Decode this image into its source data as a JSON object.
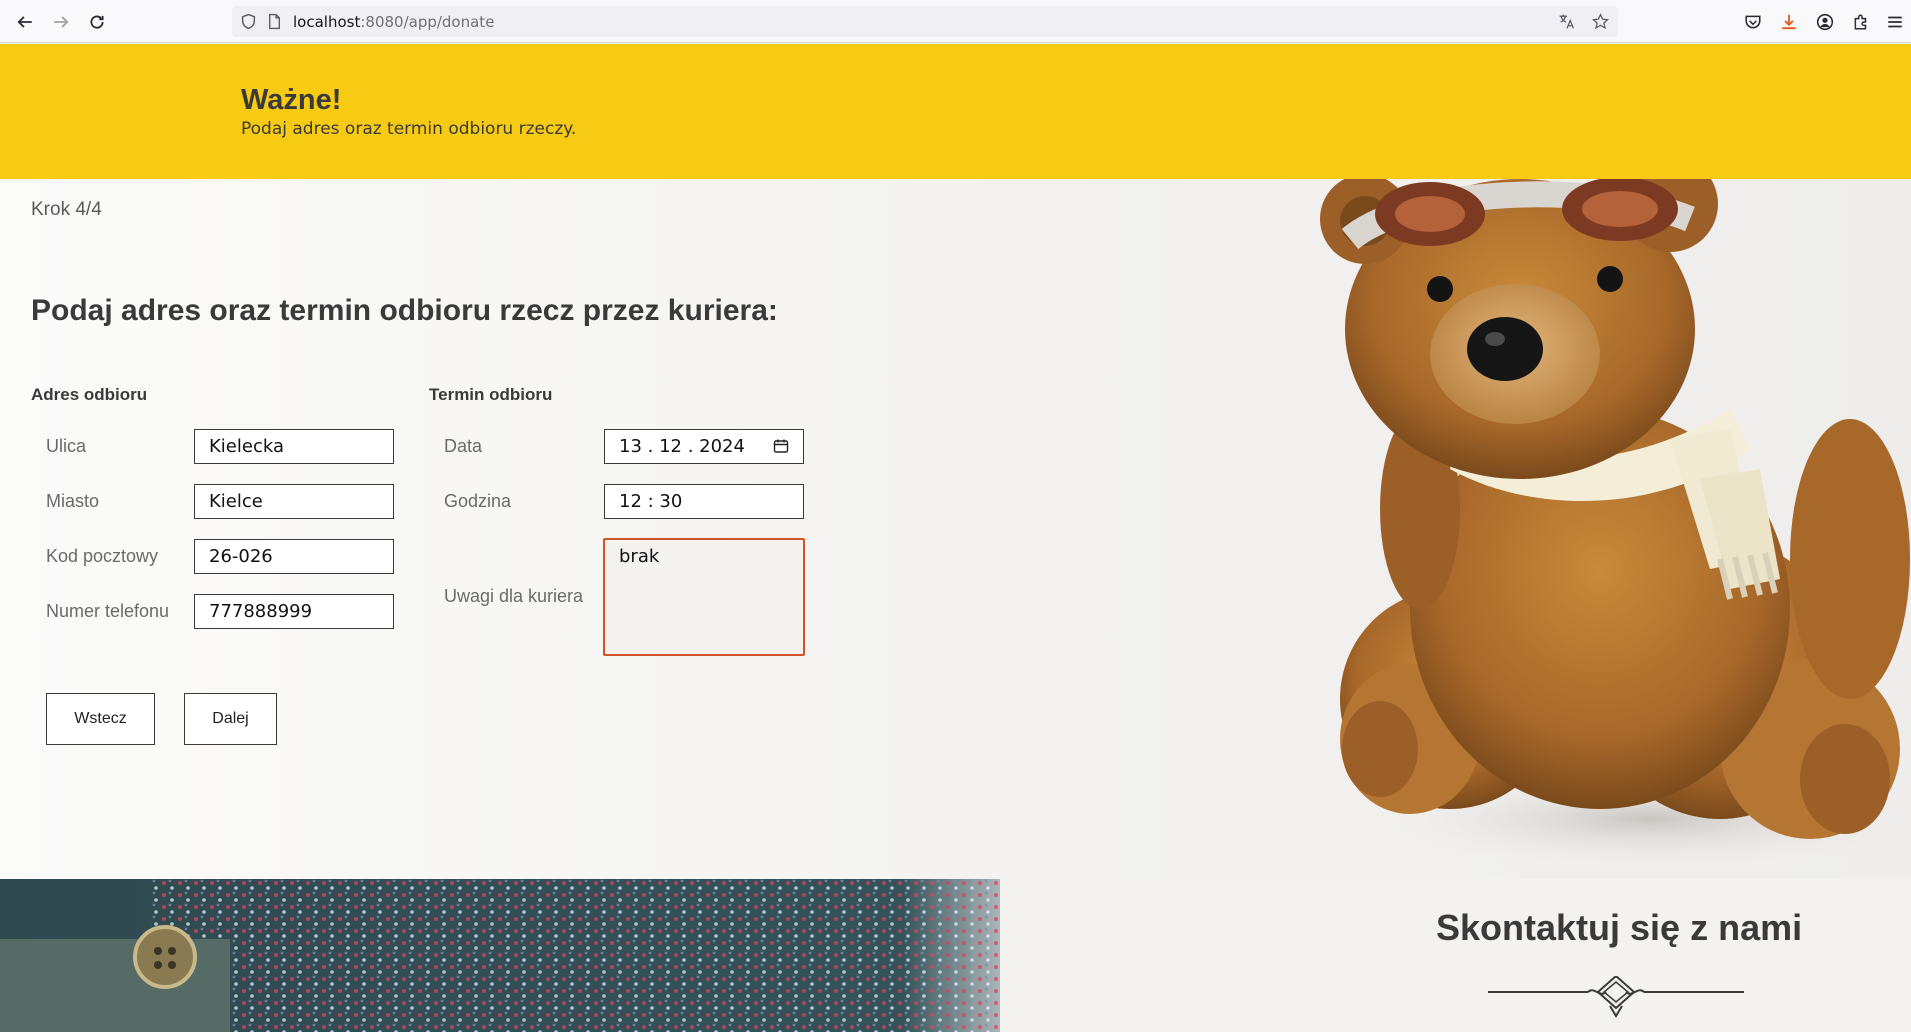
{
  "browser": {
    "url_host": "localhost",
    "url_path": ":8080/app/donate"
  },
  "banner": {
    "title": "Ważne!",
    "text": "Podaj adres oraz termin odbioru rzeczy."
  },
  "form": {
    "step": "Krok 4/4",
    "heading": "Podaj adres oraz termin odbioru rzecz przez kuriera:",
    "address": {
      "title": "Adres odbioru",
      "street_label": "Ulica",
      "street_value": "Kielecka",
      "city_label": "Miasto",
      "city_value": "Kielce",
      "zip_label": "Kod pocztowy",
      "zip_value": "26-026",
      "phone_label": "Numer telefonu",
      "phone_value": "777888999"
    },
    "pickup": {
      "title": "Termin odbioru",
      "date_label": "Data",
      "date_value": "13 . 12 . 2024",
      "time_label": "Godzina",
      "time_value": "12 : 30",
      "notes_label": "Uwagi dla kuriera",
      "notes_value": "brak"
    },
    "back_label": "Wstecz",
    "next_label": "Dalej"
  },
  "footer": {
    "contact_title": "Skontaktuj się z nami"
  },
  "icons": {
    "back": "arrow-left-icon",
    "forward": "arrow-right-icon",
    "reload": "reload-icon",
    "shield": "shield-icon",
    "page": "page-icon",
    "translate": "translate-icon",
    "bookmark": "star-icon",
    "pocket": "pocket-icon",
    "download": "download-icon",
    "account": "account-icon",
    "extensions": "extensions-icon",
    "menu": "menu-icon"
  },
  "colors": {
    "banner": "#f7ca14",
    "text": "#3a3a3a",
    "focus_border": "#d2522a"
  }
}
